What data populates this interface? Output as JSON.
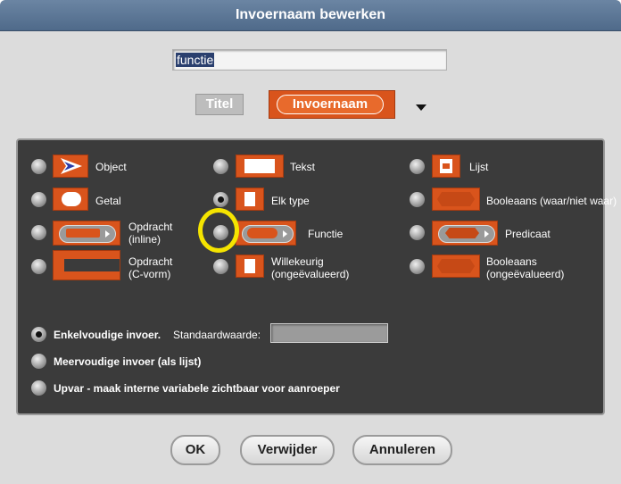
{
  "dialog": {
    "title": "Invoernaam bewerken",
    "name_value": "functie",
    "titel_label": "Titel",
    "invoernaam_label": "Invoernaam"
  },
  "types": {
    "object": "Object",
    "tekst": "Tekst",
    "lijst": "Lijst",
    "getal": "Getal",
    "elk_type": "Elk type",
    "booleaans": "Booleaans (waar/niet waar)",
    "opdracht_inline_1": "Opdracht",
    "opdracht_inline_2": "(inline)",
    "functie": "Functie",
    "predicaat": "Predicaat",
    "opdracht_c_1": "Opdracht",
    "opdracht_c_2": "(C-vorm)",
    "willekeurig_1": "Willekeurig",
    "willekeurig_2": "(ongeëvalueerd)",
    "booleaans_u_1": "Booleaans",
    "booleaans_u_2": "(ongeëvalueerd)"
  },
  "arity": {
    "single_label": "Enkelvoudige invoer.",
    "default_label": "Standaardwaarde:",
    "default_value": "",
    "multiple_label": "Meervoudige invoer (als lijst)",
    "upvar_label": "Upvar - maak interne variabele zichtbaar voor aanroeper"
  },
  "buttons": {
    "ok": "OK",
    "delete": "Verwijder",
    "cancel": "Annuleren"
  },
  "selected_type": "Elk type",
  "selected_arity": "Enkelvoudige invoer.",
  "colors": {
    "title_bar": "#5b7697",
    "block_orange": "#d9541c",
    "panel": "#3b3b3b",
    "highlight": "#f5e400"
  }
}
